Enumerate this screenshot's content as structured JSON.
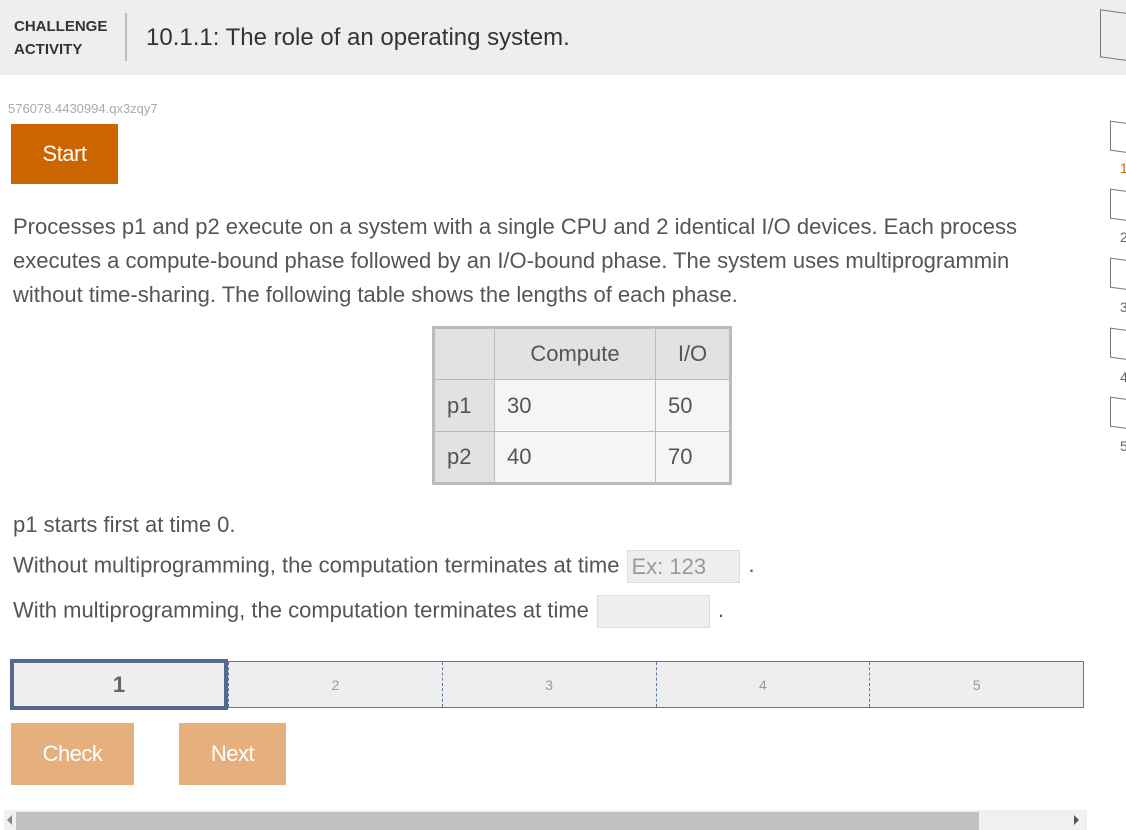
{
  "header": {
    "label_line1": "CHALLENGE",
    "label_line2": "ACTIVITY",
    "title": "10.1.1: The role of an operating system."
  },
  "activity_id": "576078.4430994.qx3zqy7",
  "start_label": "Start",
  "prompt": [
    "Processes p1 and p2 execute on a system with a single CPU and 2 identical I/O devices. Each process",
    "executes a compute-bound phase followed by an I/O-bound phase. The system uses multiprogrammin",
    "without time-sharing. The following table shows the lengths of each phase."
  ],
  "table": {
    "headers": [
      "",
      "Compute",
      "I/O"
    ],
    "rows": [
      [
        "p1",
        "30",
        "50"
      ],
      [
        "p2",
        "40",
        "70"
      ]
    ]
  },
  "q_intro": "p1 starts first at time 0.",
  "q1": {
    "text": "Without multiprogramming, the computation terminates at time",
    "placeholder": "Ex: 123",
    "suffix": "."
  },
  "q2": {
    "text": "With multiprogramming, the computation terminates at time",
    "value": "",
    "suffix": "."
  },
  "levels": [
    "1",
    "2",
    "3",
    "4",
    "5"
  ],
  "active_level": 1,
  "check_label": "Check",
  "next_label": "Next",
  "side_levels": [
    "1",
    "2",
    "3",
    "4",
    "5"
  ],
  "colors": {
    "start": "#cc6500",
    "buttons_disabled": "#e5b07d",
    "level_border": "#546a8a"
  }
}
